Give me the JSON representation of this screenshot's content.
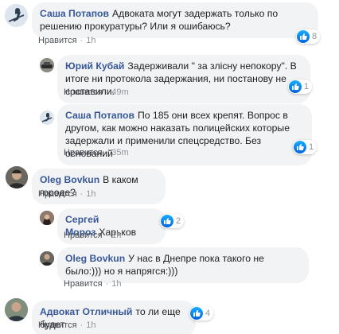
{
  "like_label": "Нравится",
  "separator": "·",
  "colors": {
    "author": "#385898",
    "bubble": "#f2f3f5",
    "like_badge": "#1877f2"
  },
  "comments": [
    {
      "author": "Саша Потапов",
      "text": "Адвоката могут задержать только по решению прокуратуры? Или я ошибаюсь?",
      "time": "1h",
      "likes": "8",
      "avatar": "skier-avatar"
    },
    {
      "author": "Юрий Кубай",
      "text": "Задерживали \" за злісну непокору\". В итоге ни протокола задержания, ни постанову не составили.",
      "time": "49m",
      "likes": "1",
      "avatar": "car-avatar"
    },
    {
      "author": "Саша Потапов",
      "text": "По 185 они всех крепят. Вопрос в другом, как можно наказать полицейских которые задержали и применили спецсредство. Без оснований",
      "time": "35m",
      "likes": "1",
      "avatar": "skier-avatar"
    },
    {
      "author": "Oleg Bovkun",
      "text": "В каком городе?",
      "time": "1h",
      "likes": "",
      "avatar": "person-avatar"
    },
    {
      "author": "Сергей Мороз",
      "text": "Харьков",
      "time": "1h",
      "likes": "2",
      "avatar": "woman-avatar"
    },
    {
      "author": "Oleg Bovkun",
      "text": "У нас в Днепре пока такого не было:))) но я напрягся:)))",
      "time": "1h",
      "likes": "",
      "avatar": "person-avatar"
    },
    {
      "author": "Адвокат Отличный",
      "text": "то ли еще будет",
      "time": "1h",
      "likes": "4",
      "avatar": "man-avatar"
    }
  ]
}
